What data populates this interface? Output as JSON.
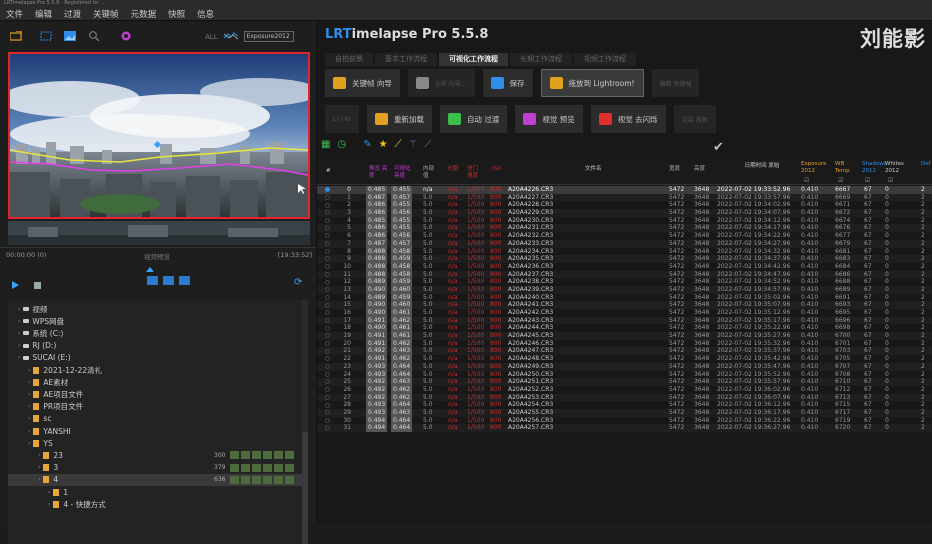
{
  "window_title": "LRTimelapse Pro 5.5.8 - Registered to: ...",
  "menu": [
    "文件",
    "编辑",
    "过渡",
    "关键帧",
    "元数据",
    "快照",
    "信息"
  ],
  "left_toolbar": {
    "all_label": "ALL",
    "dropdown_value": "Exposure2012"
  },
  "timeline": {
    "start": "00:00:00 (0)",
    "mid": "视频预览",
    "end": "[19:33:52]"
  },
  "tree": [
    {
      "indent": 1,
      "type": "drive",
      "label": "视频"
    },
    {
      "indent": 1,
      "type": "drive",
      "label": "WPS网盘"
    },
    {
      "indent": 1,
      "type": "drive",
      "label": "系统 (C:)"
    },
    {
      "indent": 1,
      "type": "drive",
      "label": "RJ (D:)"
    },
    {
      "indent": 1,
      "type": "drive",
      "label": "SUCAI (E:)"
    },
    {
      "indent": 2,
      "type": "folder",
      "label": "2021-12-22清礼"
    },
    {
      "indent": 2,
      "type": "folder",
      "label": "AE素材"
    },
    {
      "indent": 2,
      "type": "folder",
      "label": "AE项目文件"
    },
    {
      "indent": 2,
      "type": "folder",
      "label": "PR项目文件"
    },
    {
      "indent": 2,
      "type": "folder",
      "label": "sc"
    },
    {
      "indent": 2,
      "type": "folder",
      "label": "YANSHI"
    },
    {
      "indent": 2,
      "type": "folder",
      "label": "YS"
    },
    {
      "indent": 3,
      "type": "folder",
      "label": "23",
      "count": "300"
    },
    {
      "indent": 3,
      "type": "folder",
      "label": "3",
      "count": "379"
    },
    {
      "indent": 3,
      "type": "folder",
      "label": "4",
      "count": "636",
      "selected": true
    },
    {
      "indent": 4,
      "type": "folder",
      "label": "1"
    },
    {
      "indent": 4,
      "type": "folder",
      "label": "4 - 快捷方式"
    }
  ],
  "app": {
    "title_prefix": "LRT",
    "title_rest": "imelapse Pro 5.5.8",
    "logo_text": "刘能影"
  },
  "tabs": [
    "自拍前景",
    "基本工作流程",
    "可视化工作流程",
    "长期工作流程",
    "视频工作流程"
  ],
  "active_tab": 2,
  "workflow_row1": [
    {
      "label": "关键帧 向导",
      "icon_color": "#e0a020"
    },
    {
      "label": "全样 向导...",
      "icon_color": "#888",
      "dim": true
    },
    {
      "label": "保存",
      "icon_color": "#2e8ee8"
    },
    {
      "label": "拖放到 Lightroom!",
      "icon_color": "#e0a020",
      "highlight": true
    },
    {
      "label": "编辑 关键帧",
      "dim": true
    }
  ],
  "workflow_row2": [
    {
      "label": "Lr / 6r",
      "dim": true
    },
    {
      "label": "重新加载",
      "icon_color": "#e0a020"
    },
    {
      "label": "自动 过渡",
      "icon_color": "#3bbf4a"
    },
    {
      "label": "视觉 预览",
      "icon_color": "#c03fd0"
    },
    {
      "label": "视觉 去闪烁",
      "icon_color": "#e0302e"
    },
    {
      "label": "渲染 视频",
      "dim": true
    }
  ],
  "table": {
    "headers": {
      "num": "#",
      "v1": "预览 亮度",
      "v2": "可视化 亮度",
      "int": "内部 值",
      "ap": "光圈",
      "sh": "快门 速度",
      "iso": "ISO",
      "file": "文件名",
      "w": "宽度",
      "h": "高度",
      "dt": "日期时间 原始",
      "exp": "Exposure 2012",
      "wb": "WB Temp",
      "sd": "Shadows 2012",
      "wt": "Whites 2012",
      "df": "Def"
    },
    "rows": [
      [
        "0",
        "0.485",
        "0.455",
        "n/a",
        "n/a",
        "1/500",
        "800",
        "A20A4226.CR3",
        "5472",
        "3648",
        "2022-07-02 19:33:52.96",
        "0.410",
        "6667",
        "67",
        "0",
        "2"
      ],
      [
        "1",
        "0.487",
        "0.457",
        "5.0",
        "n/a",
        "1/500",
        "800",
        "A20A4227.CR3",
        "5472",
        "3648",
        "2022-07-02 19:33:57.96",
        "0.410",
        "6669",
        "67",
        "0",
        "2"
      ],
      [
        "2",
        "0.486",
        "0.455",
        "5.0",
        "n/a",
        "1/500",
        "800",
        "A20A4228.CR3",
        "5472",
        "3648",
        "2022-07-02 19:34:02.96",
        "0.410",
        "6671",
        "67",
        "0",
        "2"
      ],
      [
        "3",
        "0.486",
        "0.456",
        "5.0",
        "n/a",
        "1/500",
        "800",
        "A20A4229.CR3",
        "5472",
        "3648",
        "2022-07-02 19:34:07.96",
        "0.410",
        "6672",
        "67",
        "0",
        "2"
      ],
      [
        "4",
        "0.485",
        "0.455",
        "5.0",
        "n/a",
        "1/500",
        "800",
        "A20A4230.CR3",
        "5472",
        "3648",
        "2022-07-02 19:34:12.96",
        "0.410",
        "6674",
        "67",
        "0",
        "2"
      ],
      [
        "5",
        "0.486",
        "0.455",
        "5.0",
        "n/a",
        "1/500",
        "800",
        "A20A4231.CR3",
        "5472",
        "3648",
        "2022-07-02 19:34:17.96",
        "0.410",
        "6676",
        "67",
        "0",
        "2"
      ],
      [
        "6",
        "0.486",
        "0.456",
        "5.0",
        "n/a",
        "1/500",
        "800",
        "A20A4232.CR3",
        "5472",
        "3648",
        "2022-07-02 19:34:22.96",
        "0.410",
        "6677",
        "67",
        "0",
        "2"
      ],
      [
        "7",
        "0.487",
        "0.457",
        "5.0",
        "n/a",
        "1/500",
        "800",
        "A20A4233.CR3",
        "5472",
        "3648",
        "2022-07-02 19:34:27.96",
        "0.410",
        "6679",
        "67",
        "0",
        "2"
      ],
      [
        "8",
        "0.488",
        "0.458",
        "5.0",
        "n/a",
        "1/500",
        "800",
        "A20A4234.CR3",
        "5472",
        "3648",
        "2022-07-02 19:34:32.96",
        "0.410",
        "6681",
        "67",
        "0",
        "2"
      ],
      [
        "9",
        "0.488",
        "0.459",
        "5.0",
        "n/a",
        "1/500",
        "800",
        "A20A4235.CR3",
        "5472",
        "3648",
        "2022-07-02 19:34:37.96",
        "0.410",
        "6683",
        "67",
        "0",
        "2"
      ],
      [
        "10",
        "0.488",
        "0.458",
        "5.0",
        "n/a",
        "1/500",
        "800",
        "A20A4236.CR3",
        "5472",
        "3648",
        "2022-07-02 19:34:42.96",
        "0.410",
        "6684",
        "67",
        "0",
        "2"
      ],
      [
        "11",
        "0.488",
        "0.458",
        "5.0",
        "n/a",
        "1/500",
        "800",
        "A20A4237.CR3",
        "5472",
        "3648",
        "2022-07-02 19:34:47.96",
        "0.410",
        "6686",
        "67",
        "0",
        "2"
      ],
      [
        "12",
        "0.489",
        "0.459",
        "5.0",
        "n/a",
        "1/500",
        "800",
        "A20A4238.CR3",
        "5472",
        "3648",
        "2022-07-02 19:34:52.96",
        "0.410",
        "6688",
        "67",
        "0",
        "2"
      ],
      [
        "13",
        "0.490",
        "0.460",
        "5.0",
        "n/a",
        "1/500",
        "800",
        "A20A4239.CR3",
        "5472",
        "3648",
        "2022-07-02 19:34:57.96",
        "0.410",
        "6689",
        "67",
        "0",
        "2"
      ],
      [
        "14",
        "0.489",
        "0.459",
        "5.0",
        "n/a",
        "1/500",
        "800",
        "A20A4240.CR3",
        "5472",
        "3648",
        "2022-07-02 19:35:02.96",
        "0.410",
        "6691",
        "67",
        "0",
        "2"
      ],
      [
        "15",
        "0.490",
        "0.460",
        "5.0",
        "n/a",
        "1/500",
        "800",
        "A20A4241.CR3",
        "5472",
        "3648",
        "2022-07-02 19:35:07.96",
        "0.410",
        "6693",
        "67",
        "0",
        "2"
      ],
      [
        "16",
        "0.490",
        "0.461",
        "5.0",
        "n/a",
        "1/500",
        "800",
        "A20A4242.CR3",
        "5472",
        "3648",
        "2022-07-02 19:35:12.96",
        "0.410",
        "6695",
        "67",
        "0",
        "2"
      ],
      [
        "17",
        "0.491",
        "0.462",
        "5.0",
        "n/a",
        "1/500",
        "800",
        "A20A4243.CR3",
        "5472",
        "3648",
        "2022-07-02 19:35:17.96",
        "0.410",
        "6696",
        "67",
        "0",
        "2"
      ],
      [
        "18",
        "0.490",
        "0.461",
        "5.0",
        "n/a",
        "1/500",
        "800",
        "A20A4244.CR3",
        "5472",
        "3648",
        "2022-07-02 19:35:22.96",
        "0.410",
        "6698",
        "67",
        "0",
        "2"
      ],
      [
        "19",
        "0.491",
        "0.461",
        "5.0",
        "n/a",
        "1/500",
        "800",
        "A20A4245.CR3",
        "5472",
        "3648",
        "2022-07-02 19:35:27.96",
        "0.410",
        "6700",
        "67",
        "0",
        "2"
      ],
      [
        "20",
        "0.491",
        "0.462",
        "5.0",
        "n/a",
        "1/500",
        "800",
        "A20A4246.CR3",
        "5472",
        "3648",
        "2022-07-02 19:35:32.96",
        "0.410",
        "6701",
        "67",
        "0",
        "2"
      ],
      [
        "21",
        "0.492",
        "0.463",
        "5.0",
        "n/a",
        "1/500",
        "800",
        "A20A4247.CR3",
        "5472",
        "3648",
        "2022-07-02 19:35:37.96",
        "0.410",
        "6703",
        "67",
        "0",
        "2"
      ],
      [
        "22",
        "0.491",
        "0.462",
        "5.0",
        "n/a",
        "1/500",
        "800",
        "A20A4248.CR3",
        "5472",
        "3648",
        "2022-07-02 19:35:42.96",
        "0.410",
        "6705",
        "67",
        "0",
        "2"
      ],
      [
        "23",
        "0.493",
        "0.464",
        "5.0",
        "n/a",
        "1/500",
        "800",
        "A20A4249.CR3",
        "5472",
        "3648",
        "2022-07-02 19:35:47.96",
        "0.410",
        "6707",
        "67",
        "0",
        "2"
      ],
      [
        "24",
        "0.493",
        "0.464",
        "5.0",
        "n/a",
        "1/500",
        "800",
        "A20A4250.CR3",
        "5472",
        "3648",
        "2022-07-02 19:35:52.96",
        "0.410",
        "6708",
        "67",
        "0",
        "2"
      ],
      [
        "25",
        "0.492",
        "0.463",
        "5.0",
        "n/a",
        "1/500",
        "800",
        "A20A4251.CR3",
        "5472",
        "3648",
        "2022-07-02 19:35:57.96",
        "0.410",
        "6710",
        "67",
        "0",
        "2"
      ],
      [
        "26",
        "0.492",
        "0.462",
        "5.0",
        "n/a",
        "1/500",
        "800",
        "A20A4252.CR3",
        "5472",
        "3648",
        "2022-07-02 19:36:02.96",
        "0.410",
        "6712",
        "67",
        "0",
        "2"
      ],
      [
        "27",
        "0.492",
        "0.462",
        "5.0",
        "n/a",
        "1/500",
        "800",
        "A20A4253.CR3",
        "5472",
        "3648",
        "2022-07-02 19:36:07.96",
        "0.410",
        "6713",
        "67",
        "0",
        "2"
      ],
      [
        "28",
        "0.493",
        "0.464",
        "5.0",
        "n/a",
        "1/500",
        "800",
        "A20A4254.CR3",
        "5472",
        "3648",
        "2022-07-02 19:36:12.96",
        "0.410",
        "6715",
        "67",
        "0",
        "2"
      ],
      [
        "29",
        "0.493",
        "0.463",
        "5.0",
        "n/a",
        "1/500",
        "800",
        "A20A4255.CR3",
        "5472",
        "3648",
        "2022-07-02 19:36:17.96",
        "0.410",
        "6717",
        "67",
        "0",
        "2"
      ],
      [
        "30",
        "0.494",
        "0.464",
        "5.0",
        "n/a",
        "1/500",
        "800",
        "A20A4256.CR3",
        "5472",
        "3648",
        "2022-07-02 19:36:22.96",
        "0.410",
        "6719",
        "67",
        "0",
        "2"
      ],
      [
        "31",
        "0.494",
        "0.464",
        "5.0",
        "n/a",
        "1/500",
        "800",
        "A20A4257.CR3",
        "5472",
        "3648",
        "2022-07-02 19:36:27.96",
        "0.410",
        "6720",
        "67",
        "0",
        "2"
      ]
    ],
    "selected_row": 0
  },
  "colors": {
    "accent": "#2e8ee8",
    "red_border": "#e0262b",
    "shutter_red": "#c0302e",
    "exposure_header": "#e0a020",
    "wb_header": "#e0a020"
  }
}
